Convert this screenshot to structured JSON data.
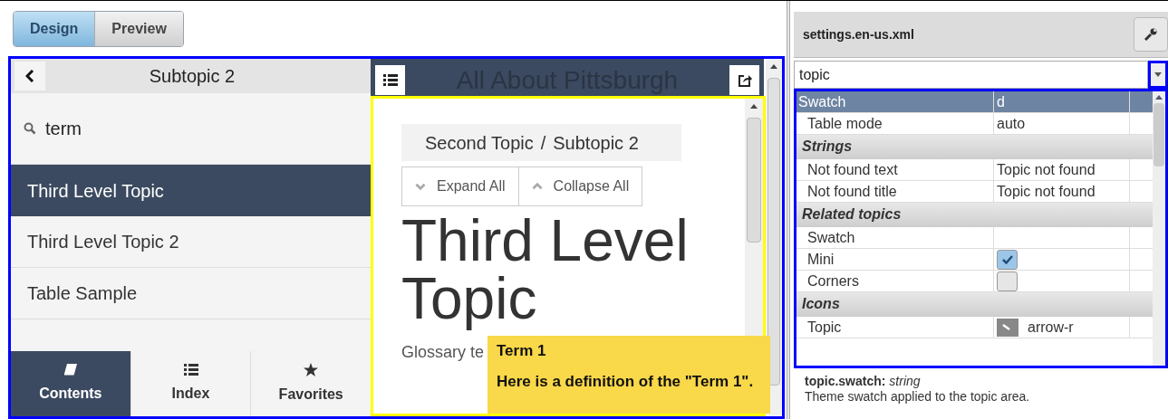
{
  "mode_tabs": [
    {
      "label": "Design",
      "selected": true
    },
    {
      "label": "Preview",
      "selected": false
    }
  ],
  "nav_panel": {
    "title": "Subtopic 2",
    "search": {
      "value": "term"
    },
    "items": [
      {
        "label": "Third Level Topic",
        "selected": true
      },
      {
        "label": "Third Level Topic 2",
        "selected": false
      },
      {
        "label": "Table Sample",
        "selected": false
      }
    ],
    "bottom_tabs": [
      {
        "label": "Contents",
        "selected": true
      },
      {
        "label": "Index",
        "selected": false
      },
      {
        "label": "Favorites",
        "selected": false
      }
    ]
  },
  "topic_header": {
    "title": "All About Pittsburgh"
  },
  "content": {
    "breadcrumb": [
      "Second Topic",
      "Subtopic 2"
    ],
    "breadcrumb_separator": "/",
    "buttons": [
      {
        "label": "Expand All",
        "kind": "expand"
      },
      {
        "label": "Collapse All",
        "kind": "collapse"
      }
    ],
    "heading": "Third Level Topic",
    "body": "Glossary te"
  },
  "tooltip": {
    "title": "Term 1",
    "text": "Here is a definition of the \"Term 1\"."
  },
  "settings": {
    "file": "settings.en-us.xml",
    "filter": {
      "value": "topic"
    },
    "rows": [
      {
        "kind": "value",
        "label": "Swatch",
        "value": "d",
        "selected": true
      },
      {
        "kind": "value",
        "label": "Table mode",
        "value": "auto",
        "selected": false
      },
      {
        "kind": "group",
        "label": "Strings"
      },
      {
        "kind": "value",
        "label": "Not found text",
        "value": "Topic not found",
        "selected": false
      },
      {
        "kind": "value",
        "label": "Not found title",
        "value": "Topic not found",
        "selected": false
      },
      {
        "kind": "group",
        "label": "Related topics"
      },
      {
        "kind": "value",
        "label": "Swatch",
        "selected": false
      },
      {
        "kind": "check",
        "label": "Mini",
        "checked": true,
        "selected": false
      },
      {
        "kind": "check",
        "label": "Corners",
        "checked": false,
        "selected": false
      },
      {
        "kind": "group",
        "label": "Icons"
      },
      {
        "kind": "icon_value",
        "label": "Topic",
        "value": "arrow-r",
        "selected": false
      }
    ],
    "description": {
      "signature": "**topic.swatch:** *string*",
      "text": "Theme swatch applied to the topic area."
    }
  }
}
